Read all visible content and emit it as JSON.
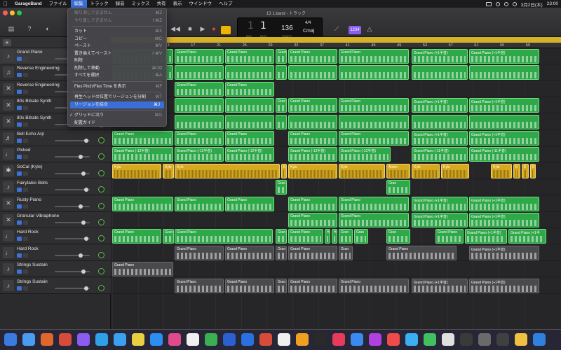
{
  "menubar": {
    "apple": "",
    "items": [
      "GarageBand",
      "ファイル",
      "編集",
      "トラック",
      "録音",
      "ミックス",
      "共有",
      "表示",
      "ウインドウ",
      "ヘルプ"
    ],
    "active_index": 2,
    "date": "3月2日(木)",
    "time": "23:00"
  },
  "window": {
    "title": "13 1.band - トラック"
  },
  "lcd": {
    "bar": "1",
    "beat": "1",
    "bar_label": "BAR",
    "beat_label": "BEAT",
    "tempo": "136",
    "tempo_label": "TEMPO",
    "signature": "4/4",
    "key": "Cmaj"
  },
  "count_in": "1234",
  "edit_menu": {
    "items": [
      {
        "label": "取り消しできません",
        "key": "⌘Z",
        "disabled": true
      },
      {
        "label": "やり直しできません",
        "key": "⇧⌘Z",
        "disabled": true
      },
      {
        "sep": true
      },
      {
        "label": "カット",
        "key": "⌘X",
        "disabled": false
      },
      {
        "label": "コピー",
        "key": "⌘C",
        "disabled": false
      },
      {
        "label": "ペースト",
        "key": "⌘V",
        "disabled": false
      },
      {
        "label": "置き換えてペースト",
        "key": "⇧⌘V",
        "disabled": false
      },
      {
        "label": "削除",
        "key": "",
        "disabled": false
      },
      {
        "label": "削除して移動",
        "key": "⌘⌫",
        "disabled": false
      },
      {
        "label": "すべてを選択",
        "key": "⌘A",
        "disabled": false
      },
      {
        "sep": true
      },
      {
        "label": "Flex Pitch/Flex Time を表示",
        "key": "⌘F",
        "disabled": false
      },
      {
        "sep": true
      },
      {
        "label": "再生ヘッドの位置でリージョンを分割",
        "key": "⌘T",
        "disabled": false
      },
      {
        "label": "リージョンを結合",
        "key": "⌘J",
        "disabled": false,
        "highlight": true
      },
      {
        "sep": true
      },
      {
        "label": "グリッドに沿う",
        "key": "⌘G",
        "disabled": false,
        "checked": true
      },
      {
        "label": "配置ガイド",
        "key": "",
        "disabled": false
      }
    ]
  },
  "ruler_ticks": [
    "5",
    "9",
    "13",
    "17",
    "21",
    "25",
    "29",
    "33",
    "37",
    "41",
    "45",
    "49",
    "53",
    "57",
    "61",
    "65",
    "69"
  ],
  "tracks": [
    {
      "name": "Grand Piano",
      "icon": "keyboard-icon",
      "glyph": "♪",
      "selected": true
    },
    {
      "name": "Reverse Engineering",
      "icon": "piano-icon",
      "glyph": "♫",
      "selected": false
    },
    {
      "name": "Reverse Engineering",
      "icon": "synth-icon",
      "glyph": "✕",
      "selected": false
    },
    {
      "name": "80s Bitrate Synth",
      "icon": "synth-icon",
      "glyph": "✕",
      "selected": false
    },
    {
      "name": "80s Bitrate Synth",
      "icon": "synth-icon",
      "glyph": "✕",
      "selected": false
    },
    {
      "name": "Bell Echo Arp",
      "icon": "bell-icon",
      "glyph": "♬",
      "selected": false
    },
    {
      "name": "Picked",
      "icon": "guitar-icon",
      "glyph": "♩",
      "selected": false
    },
    {
      "name": "SoCal (Kyle)",
      "icon": "drums-icon",
      "glyph": "✱",
      "selected": false
    },
    {
      "name": "Fairytales Bells",
      "icon": "bells-icon",
      "glyph": "♪",
      "selected": false
    },
    {
      "name": "Rusty Piano",
      "icon": "synth-icon",
      "glyph": "✕",
      "selected": false
    },
    {
      "name": "Granular Vibraphone",
      "icon": "synth-icon",
      "glyph": "✕",
      "selected": false
    },
    {
      "name": "Hard Rock",
      "icon": "guitar-icon",
      "glyph": "♩",
      "selected": false
    },
    {
      "name": "Hard Rock",
      "icon": "guitar-icon",
      "glyph": "♩",
      "selected": false
    },
    {
      "name": "Strings Sustain",
      "icon": "strings-icon",
      "glyph": "♪",
      "selected": false
    },
    {
      "name": "Strings Sustain",
      "icon": "strings-icon",
      "glyph": "♪",
      "selected": false
    }
  ],
  "regions": [
    [
      [
        "green",
        "Grand Piano",
        0,
        87
      ],
      [
        "green",
        "Grand Piano",
        89,
        70
      ],
      [
        "green",
        "Grand Piano",
        161,
        70
      ],
      [
        "green",
        "Grand Piano",
        233,
        16
      ],
      [
        "green",
        "Grand Piano",
        251,
        70
      ],
      [
        "green",
        "Grand Piano",
        323,
        100
      ],
      [
        "green",
        "Grand Piano (+1半音)",
        427,
        80
      ],
      [
        "green",
        "Grand Piano (+1半音)",
        509,
        100
      ]
    ],
    [
      [
        "green",
        "",
        0,
        87
      ],
      [
        "green",
        "",
        89,
        70
      ],
      [
        "green",
        "",
        161,
        70
      ],
      [
        "green",
        "",
        233,
        16
      ],
      [
        "green",
        "",
        251,
        70
      ],
      [
        "green",
        "",
        323,
        100
      ],
      [
        "green",
        "",
        427,
        80
      ],
      [
        "green",
        "",
        509,
        100
      ]
    ],
    [
      [
        "green",
        "Grand Piano",
        89,
        70
      ],
      [
        "green",
        "Grand Piano",
        161,
        70
      ]
    ],
    [
      [
        "green",
        "",
        89,
        70
      ],
      [
        "green",
        "",
        161,
        70
      ],
      [
        "green",
        "Gran",
        233,
        16
      ],
      [
        "green",
        "Grand Piano",
        251,
        70
      ],
      [
        "green",
        "Grand Piano",
        323,
        100
      ],
      [
        "green",
        "Grand Piano (+1半音)",
        427,
        80
      ],
      [
        "green",
        "Grand Piano (+1半音)",
        509,
        100
      ]
    ],
    [
      [
        "green",
        "",
        89,
        70
      ],
      [
        "green",
        "",
        161,
        70
      ],
      [
        "green",
        "",
        233,
        16
      ],
      [
        "green",
        "",
        251,
        70
      ],
      [
        "green",
        "",
        323,
        100
      ],
      [
        "green",
        "",
        427,
        80
      ],
      [
        "green",
        "",
        509,
        100
      ]
    ],
    [
      [
        "green",
        "Grand Piano",
        0,
        87
      ],
      [
        "green",
        "Grand Piano",
        89,
        70
      ],
      [
        "green",
        "Grand Piano",
        161,
        70
      ],
      [
        "green",
        "Grand Piano",
        251,
        70
      ],
      [
        "green",
        "Grand Piano",
        323,
        100
      ],
      [
        "green",
        "Grand Piano (+1半音)",
        427,
        80
      ],
      [
        "green",
        "Grand Piano (+1半音)",
        509,
        100
      ]
    ],
    [
      [
        "green",
        "Grand Piano (-12半音)",
        0,
        87
      ],
      [
        "green",
        "Grand Piano (-12半音)",
        89,
        70
      ],
      [
        "green",
        "Grand Piano (-12半音)",
        161,
        70
      ],
      [
        "green",
        "Grand Piano (-12半音)",
        251,
        70
      ],
      [
        "green",
        "Grand Piano (-12半音)",
        323,
        74
      ],
      [
        "green",
        "Grand Piano (-11半音)",
        427,
        80
      ],
      [
        "green",
        "Grand Piano (-11半音)",
        509,
        100
      ]
    ],
    [
      [
        "yellow",
        "Kyle",
        0,
        70
      ],
      [
        "yellow",
        "Kyle",
        72,
        16
      ],
      [
        "yellow",
        "Kyle",
        89,
        150
      ],
      [
        "yellow",
        "Kyle",
        241,
        8
      ],
      [
        "yellow",
        "Kyle",
        251,
        70
      ],
      [
        "yellow",
        "Kyle",
        323,
        66
      ],
      [
        "yellow",
        "Anton",
        391,
        34
      ],
      [
        "yellow",
        "Kyle",
        427,
        40
      ],
      [
        "yellow",
        "Kyle",
        469,
        40
      ],
      [
        "yellow",
        "Kyle",
        540,
        30
      ],
      [
        "yellow",
        "K",
        572,
        10
      ],
      [
        "yellow",
        "K",
        584,
        10
      ],
      [
        "yellow",
        "K",
        596,
        8
      ]
    ],
    [
      [
        "green",
        "Gran",
        233,
        16
      ],
      [
        "green",
        "Gran",
        391,
        34
      ]
    ],
    [
      [
        "green",
        "Grand Piano",
        0,
        87
      ],
      [
        "green",
        "Grand Piano",
        89,
        70
      ],
      [
        "green",
        "Grand Piano",
        161,
        70
      ],
      [
        "green",
        "Grand Piano",
        251,
        70
      ],
      [
        "green",
        "Grand Piano",
        323,
        100
      ],
      [
        "green",
        "Grand Piano (+1半音)",
        427,
        80
      ],
      [
        "green",
        "Grand Piano (+1半音)",
        509,
        100
      ]
    ],
    [
      [
        "green",
        "Grand Piano",
        251,
        70
      ],
      [
        "green",
        "Grand Piano",
        323,
        100
      ],
      [
        "green",
        "Grand Piano (+1半音)",
        427,
        80
      ],
      [
        "green",
        "Grand Piano (+1半音)",
        509,
        100
      ]
    ],
    [
      [
        "green",
        "Grand Piano",
        0,
        70
      ],
      [
        "green",
        "Gran",
        72,
        16
      ],
      [
        "green",
        "Grand Piano",
        89,
        140
      ],
      [
        "green",
        "Gran",
        233,
        16
      ],
      [
        "green",
        "Grand Piano",
        251,
        50
      ],
      [
        "green",
        "H",
        303,
        8
      ],
      [
        "green",
        "H",
        313,
        8
      ],
      [
        "green",
        "Gran",
        323,
        20
      ],
      [
        "green",
        "Gran",
        345,
        20
      ],
      [
        "green",
        "Gran",
        391,
        34
      ],
      [
        "green",
        "Grand Piano",
        461,
        40
      ],
      [
        "green",
        "Grand Piano (+1半音)",
        503,
        60
      ],
      [
        "green",
        "Grand Piano (+1半",
        565,
        54
      ]
    ],
    [
      [
        "grey",
        "Grand Piano",
        89,
        70
      ],
      [
        "grey",
        "Grand Piano",
        161,
        70
      ],
      [
        "grey",
        "Gran",
        233,
        16
      ],
      [
        "grey",
        "Grand Piano",
        251,
        70
      ],
      [
        "grey",
        "Gran",
        323,
        20
      ],
      [
        "grey",
        "Grand Piano",
        391,
        100
      ],
      [
        "grey",
        "Grand Piano (+1半音)",
        509,
        100
      ]
    ],
    [
      [
        "grey",
        "Grand Piano",
        0,
        87
      ]
    ],
    [
      [
        "grey",
        "Grand Piano",
        89,
        70
      ],
      [
        "grey",
        "Grand Piano",
        161,
        70
      ],
      [
        "grey",
        "Gran",
        233,
        16
      ],
      [
        "grey",
        "Grand Piano",
        251,
        70
      ],
      [
        "grey",
        "Grand Piano",
        323,
        100
      ],
      [
        "grey",
        "Grand Piano (+1半音)",
        427,
        80
      ],
      [
        "grey",
        "Grand Piano (+1半音)",
        509,
        100
      ]
    ]
  ],
  "dock_colors": [
    "#3b7be0",
    "#4a9cf0",
    "#e0672b",
    "#d84a3a",
    "#8a5cf0",
    "#2ea0e8",
    "#3aa0f0",
    "#e8d040",
    "#2a8ff0",
    "#e04a8a",
    "#f0f0f0",
    "#3ab050",
    "#2a60d0",
    "#2a70e0",
    "#d84a3a",
    "#f0f0f0",
    "#f0a020",
    "#2a2a2a",
    "#e83a5a",
    "#3a8af0",
    "#b040e0",
    "#f04a4a",
    "#3ab0f0",
    "#40c060",
    "#e0e0e0",
    "#3a3a3a",
    "#6a6a6a",
    "#404040",
    "#f0c040",
    "#3080e0"
  ]
}
